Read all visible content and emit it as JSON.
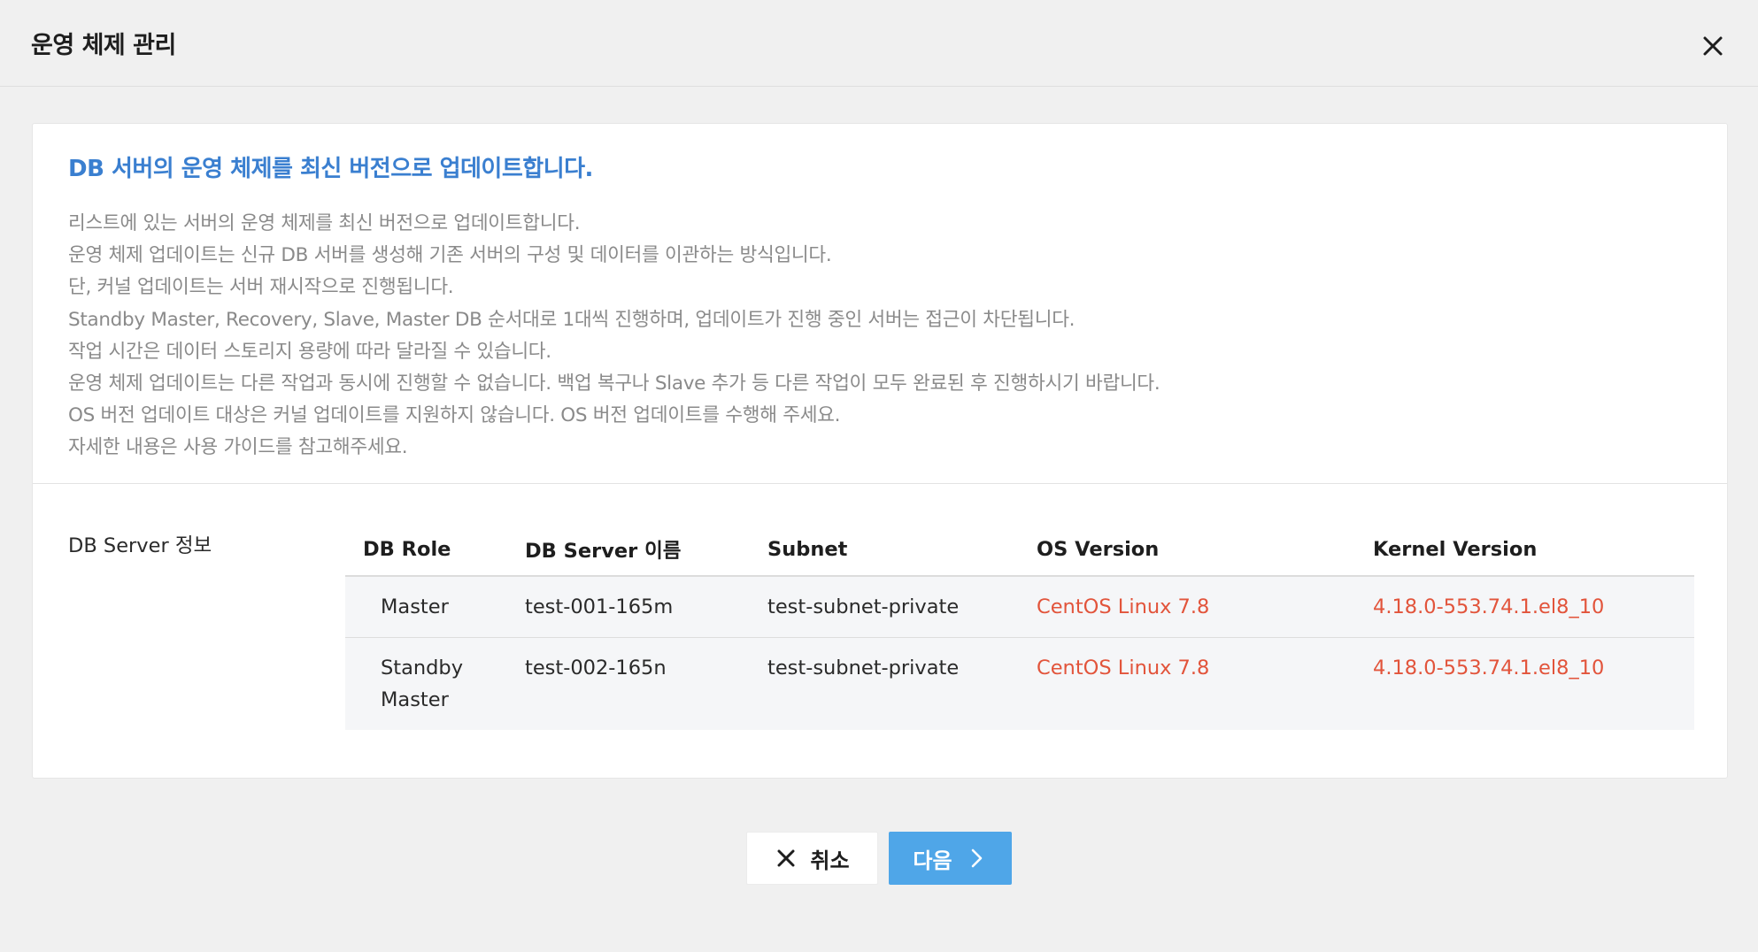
{
  "header": {
    "title": "운영 체제 관리",
    "close_icon": "close-icon"
  },
  "notice": {
    "headline": "DB 서버의 운영 체제를 최신 버전으로 업데이트합니다.",
    "lines": [
      "리스트에 있는 서버의 운영 체제를 최신 버전으로 업데이트합니다.",
      "운영 체제 업데이트는 신규 DB 서버를 생성해 기존 서버의 구성 및 데이터를 이관하는 방식입니다.",
      "단, 커널 업데이트는 서버 재시작으로 진행됩니다.",
      "Standby Master, Recovery, Slave, Master DB 순서대로 1대씩 진행하며, 업데이트가 진행 중인 서버는 접근이 차단됩니다.",
      "작업 시간은 데이터 스토리지 용량에 따라 달라질 수 있습니다.",
      "운영 체제 업데이트는 다른 작업과 동시에 진행할 수 없습니다. 백업 복구나 Slave 추가 등 다른 작업이 모두 완료된 후 진행하시기 바랍니다.",
      "OS 버전 업데이트 대상은 커널 업데이트를 지원하지 않습니다. OS 버전 업데이트를 수행해 주세요.",
      "자세한 내용은 사용 가이드를 참고해주세요."
    ]
  },
  "server_info": {
    "label": "DB Server 정보",
    "columns": [
      "DB Role",
      "DB Server 이름",
      "Subnet",
      "OS Version",
      "Kernel Version"
    ],
    "rows": [
      {
        "role": "Master",
        "name": "test-001-165m",
        "subnet": "test-subnet-private",
        "os_version": "CentOS Linux 7.8",
        "kernel_version": "4.18.0-553.74.1.el8_10"
      },
      {
        "role": "Standby Master",
        "name": "test-002-165n",
        "subnet": "test-subnet-private",
        "os_version": "CentOS Linux 7.8",
        "kernel_version": "4.18.0-553.74.1.el8_10"
      }
    ]
  },
  "footer": {
    "cancel_label": "취소",
    "next_label": "다음"
  },
  "colors": {
    "headline": "#3a7fd0",
    "version_text": "#e2543b",
    "next_button": "#4fa6e8"
  }
}
